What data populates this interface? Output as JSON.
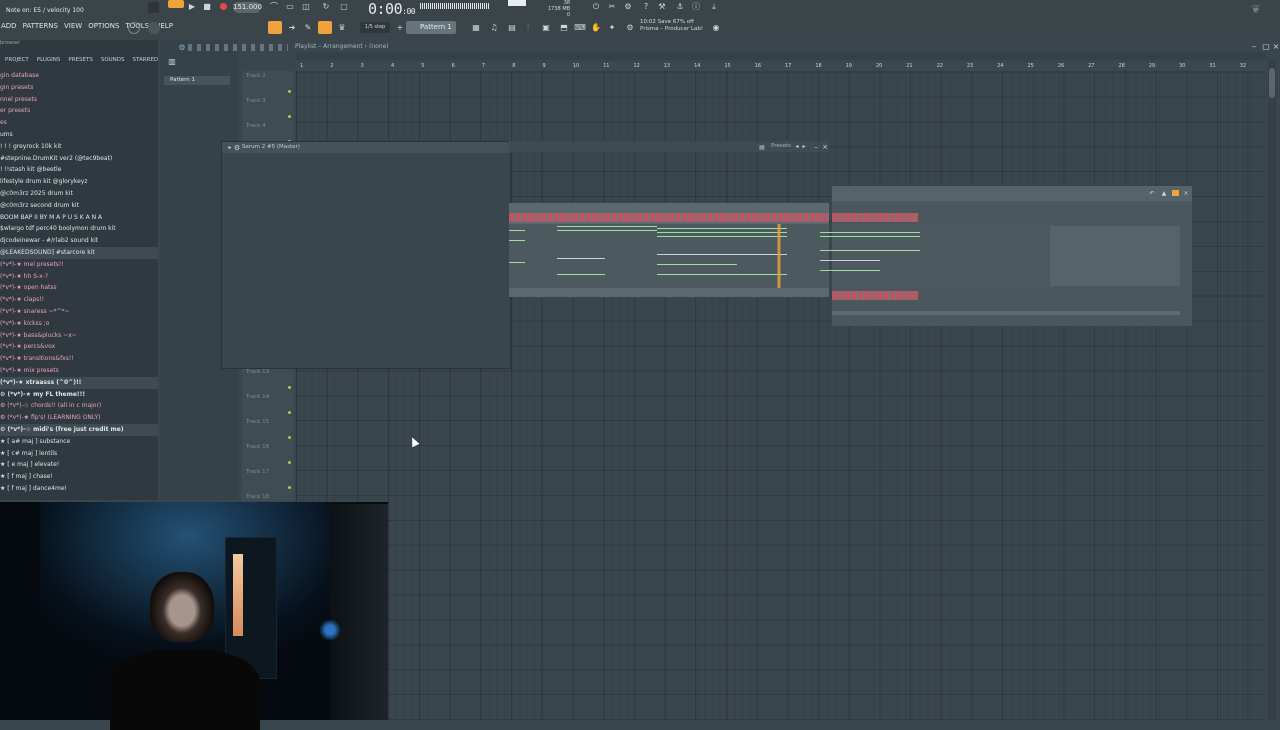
{
  "toolbar": {
    "hint": "Note on: E5 / velocity 100",
    "menu": [
      "ADD",
      "PATTERNS",
      "VIEW",
      "OPTIONS",
      "TOOLS",
      "HELP"
    ],
    "tempo": "151.000",
    "song_time": "0:00",
    "song_time_small": ":00",
    "cpu": "38",
    "mem": "1738 MB",
    "mem_sub": "0",
    "step": "1/5 step",
    "pattern": "Pattern 1",
    "promo_line1": "10:02  Save 67% off",
    "promo_line2": "Prisma – Producer Lab!"
  },
  "browser": {
    "tabs": [
      "PROJECT",
      "PLUGINS",
      "PRESETS",
      "SOUNDS",
      "STARRED"
    ],
    "header": "browser",
    "items": [
      {
        "label": "gin database",
        "style": "pink"
      },
      {
        "label": "gin presets",
        "style": "pink"
      },
      {
        "label": "nnel presets",
        "style": "pink"
      },
      {
        "label": "er presets",
        "style": "pink"
      },
      {
        "label": "es",
        "style": "pink"
      },
      {
        "label": "ums",
        "style": "white"
      },
      {
        "label": "! ! ! greyrock 10k kit",
        "style": "white"
      },
      {
        "label": "#stepnine.DrumKit ver2 (@tec9beat)",
        "style": "white"
      },
      {
        "label": "! !!stash kit @beetle",
        "style": "white"
      },
      {
        "label": "lifestyle drum kit @glorykeyz",
        "style": "white"
      },
      {
        "label": "@c0m3rz 2025 drum kit",
        "style": "white"
      },
      {
        "label": "@c0m3rz second drum kit",
        "style": "white"
      },
      {
        "label": "BOOM BAP II BY M A P U S K A N A",
        "style": "white"
      },
      {
        "label": "$wlargo tdf perc40 boolymon drum kit",
        "style": "white"
      },
      {
        "label": "djcodeinewar - #/rlab2 sound kit",
        "style": "white"
      },
      {
        "label": "@LEAKEDSOUND] #starcore kit",
        "style": "white-hl"
      },
      {
        "label": "(*v*)-★ mel presets!!",
        "style": "pink"
      },
      {
        "label": "(*v*)-★ hh S-x-?",
        "style": "pink"
      },
      {
        "label": "(*v*)-★ open hatss",
        "style": "pink"
      },
      {
        "label": "(*v*)-★ claps!!",
        "style": "pink"
      },
      {
        "label": "(*v*)-★ snaress ~*^*~",
        "style": "pink"
      },
      {
        "label": "(*v*)-★ kickss ;o",
        "style": "pink"
      },
      {
        "label": "(*v*)-★ bass&plucks ~x~",
        "style": "pink"
      },
      {
        "label": "(*v*)-★ percs&vox",
        "style": "pink"
      },
      {
        "label": "(*v*)-★ transitions&fxs!!",
        "style": "pink"
      },
      {
        "label": "(*v*)-★ mix presets",
        "style": "pink"
      },
      {
        "label": "(*v*)-★ xtraasss (^0^)!!",
        "style": "white-hl-bold"
      },
      {
        "label": "⚙ (*v*)-★ my FL theme!!!",
        "style": "white-bold"
      },
      {
        "label": "⚙ (*v*)-☆ chords!! (all in c major)",
        "style": "pink"
      },
      {
        "label": "⚙ (*v*)-★ flp's! (LEARNING ONLY)",
        "style": "pink"
      },
      {
        "label": "⚙ (*v*)-☆ midi's (free just credit me)",
        "style": "white-hl-bold"
      },
      {
        "label": "   ★ [ a# maj ] substance",
        "style": "white"
      },
      {
        "label": "   ★ [ c# maj ] lentils",
        "style": "white"
      },
      {
        "label": "   ★ [ e maj ] elevate!",
        "style": "white"
      },
      {
        "label": "   ★ [ f maj ] chase!",
        "style": "white"
      },
      {
        "label": "   ★ [ f maj ] dance4me!",
        "style": "white"
      }
    ]
  },
  "pattern_list": {
    "selected": "Pattern 1"
  },
  "playlist": {
    "title": "Playlist – Arrangement › (none)",
    "bars": [
      "1",
      "2",
      "3",
      "4",
      "5",
      "6",
      "7",
      "8",
      "9",
      "10",
      "11",
      "12",
      "13",
      "14",
      "15",
      "16",
      "17",
      "18",
      "19",
      "20",
      "21",
      "22",
      "23",
      "24",
      "25",
      "26",
      "27",
      "28",
      "29",
      "30",
      "31",
      "32"
    ],
    "tracks_visible_top": [
      "Track 2",
      "Track 3",
      "Track 4"
    ],
    "tracks_visible_bottom": [
      "Track 13",
      "Track 14",
      "Track 15",
      "Track 16",
      "Track 17",
      "Track 18"
    ]
  },
  "serum": {
    "title": "Serum 2 #5 (Master)",
    "presets_label": "Presets"
  },
  "colors": {
    "accent_orange": "#f0a23c",
    "note_green": "#9fdca0",
    "key_red": "#b95660"
  }
}
